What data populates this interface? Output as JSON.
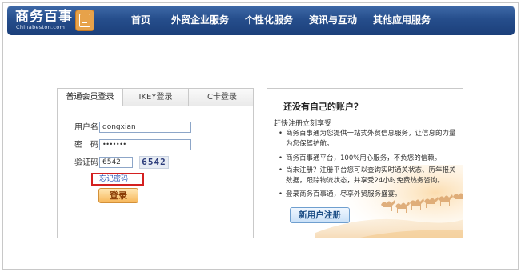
{
  "header": {
    "logo_text": "商务百事",
    "logo_sub": "Chinabeston.com",
    "nav": [
      {
        "label": "首页"
      },
      {
        "label": "外贸企业服务"
      },
      {
        "label": "个性化服务"
      },
      {
        "label": "资讯与互动"
      },
      {
        "label": "其他应用服务"
      }
    ]
  },
  "login": {
    "tabs": [
      {
        "label": "普通会员登录",
        "active": true
      },
      {
        "label": "IKEY登录",
        "active": false
      },
      {
        "label": "IC卡登录",
        "active": false
      }
    ],
    "username_label": "用户名:",
    "username_value": "dongxian",
    "password_label": "密　码:",
    "password_value": "•••••••",
    "captcha_label": "验证码:",
    "captcha_value": "6542",
    "captcha_image_text": "6542",
    "forgot_link": "忘记密码",
    "login_button": "登录"
  },
  "register": {
    "title": "还没有自己的账户？",
    "subtitle": "赶快注册立刻享受",
    "bullets": [
      "商务百事通为您提供一站式外贸信息服务，让信息的力量为您保驾护航。",
      "商务百事通平台，100%用心服务，不负您的信赖。",
      "尚未注册？注册平台您可以查询实时通关状态、历年报关数据，跟踪物流状态，并享受24小时免费热务咨询。",
      "登录商务百事通，尽享外贸服务盛宴。"
    ],
    "bullet_symbol": "•",
    "register_button": "新用户注册"
  },
  "colors": {
    "header_bg": "#264e8c",
    "link": "#2a55b5",
    "highlight_border": "#d42020",
    "login_button": "#f7b75a",
    "register_button": "#c9e0f7"
  }
}
